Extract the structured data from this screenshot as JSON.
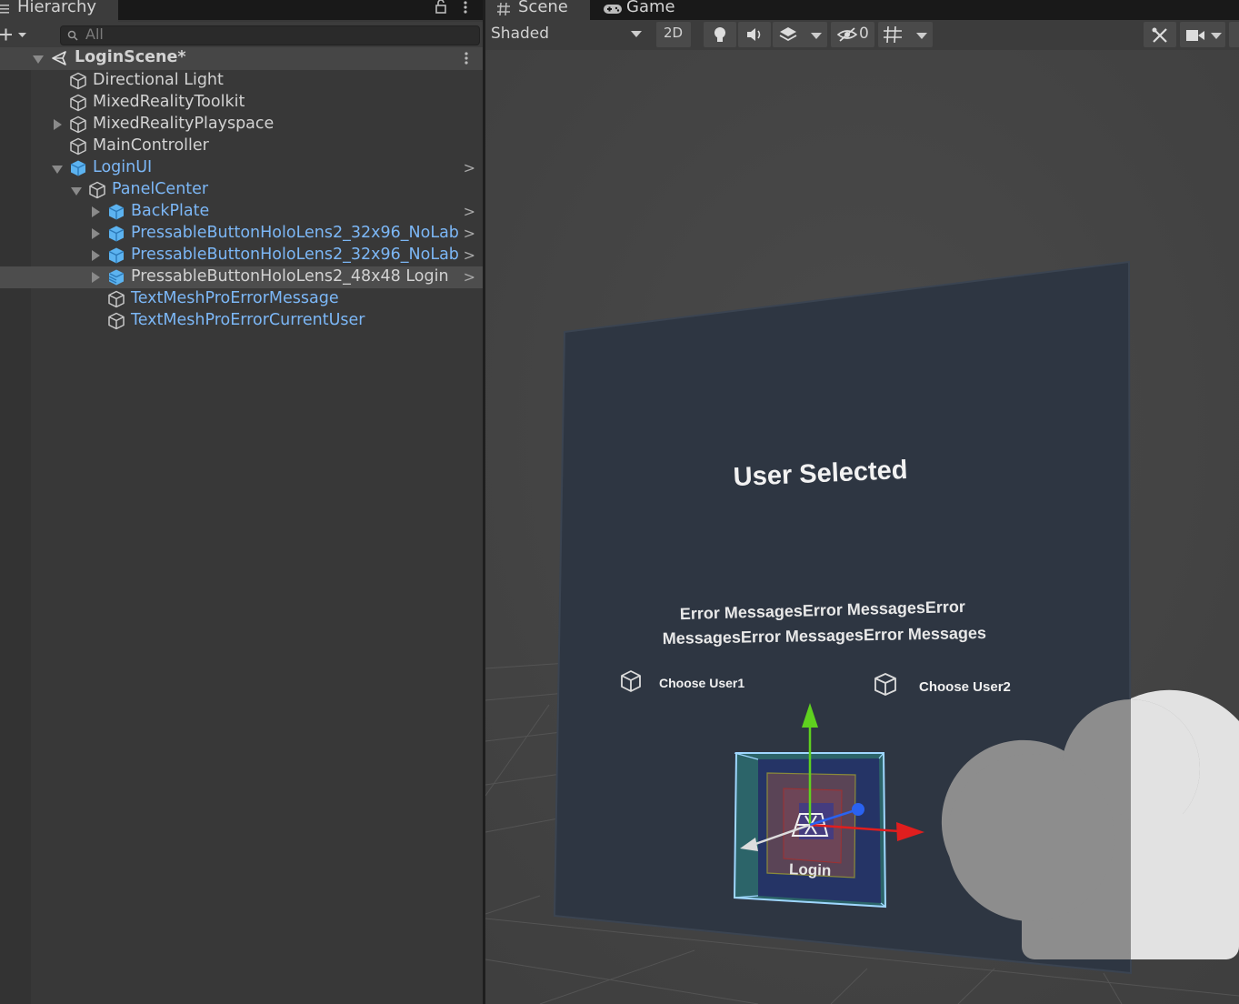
{
  "hierarchy": {
    "title": "Hierarchy",
    "search_placeholder": "All",
    "scene_name": "LoginScene*",
    "items": [
      {
        "label": "Directional Light"
      },
      {
        "label": "MixedRealityToolkit"
      },
      {
        "label": "MixedRealityPlayspace"
      },
      {
        "label": "MainController"
      },
      {
        "label": "LoginUI"
      },
      {
        "label": "PanelCenter"
      },
      {
        "label": "BackPlate"
      },
      {
        "label": "PressableButtonHoloLens2_32x96_NoLab"
      },
      {
        "label": "PressableButtonHoloLens2_32x96_NoLab"
      },
      {
        "label": "PressableButtonHoloLens2_48x48 Login"
      },
      {
        "label": "TextMeshProErrorMessage"
      },
      {
        "label": "TextMeshProErrorCurrentUser"
      }
    ]
  },
  "scene_view": {
    "tab_scene": "Scene",
    "tab_game": "Game",
    "shading_mode": "Shaded",
    "mode_2d": "2D",
    "hidden_count": "0",
    "panel_title": "User Selected",
    "error_line1": "Error MessagesError MessagesError",
    "error_line2": "MessagesError MessagesError Messages",
    "choose_user1": "Choose User1",
    "choose_user2": "Choose User2",
    "login_label": "Login"
  },
  "colors": {
    "panel": "#383838",
    "scene_bg": "#474747",
    "blue_text": "#7cb7f6",
    "gizmo_y": "#5fd11f",
    "gizmo_x": "#e01e1e",
    "gizmo_z": "#2a62f0"
  }
}
